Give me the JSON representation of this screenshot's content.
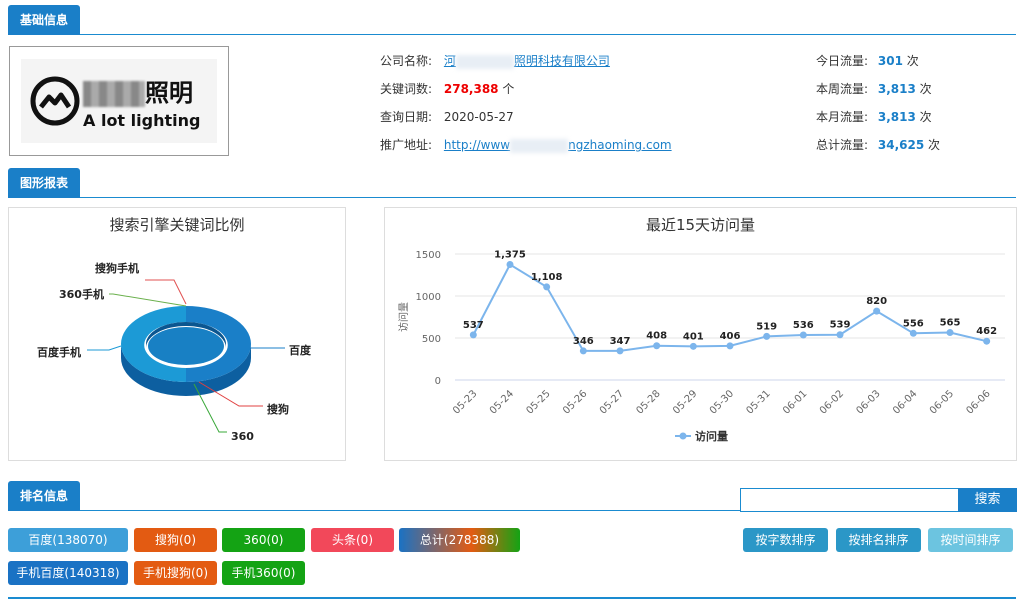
{
  "sections": {
    "basic": "基础信息",
    "chart": "图形报表",
    "ranking": "排名信息"
  },
  "logo": {
    "brand_cn": "照明",
    "brand_en": "A lot lighting"
  },
  "info": {
    "company_label": "公司名称:",
    "company_prefix": "河",
    "company_value": "照明科技有限公司",
    "keywords_label": "关键词数:",
    "keywords_value": "278,388",
    "keywords_unit": "个",
    "date_label": "查询日期:",
    "date_value": "2020-05-27",
    "url_label": "推广地址:",
    "url_prefix": "http://www",
    "url_suffix": "ngzhaoming.com",
    "today_label": "今日流量:",
    "today_value": "301",
    "week_label": "本周流量:",
    "week_value": "3,813",
    "month_label": "本月流量:",
    "month_value": "3,813",
    "total_label": "总计流量:",
    "total_value": "34,625",
    "unit": "次"
  },
  "chart_data": [
    {
      "type": "pie",
      "title": "搜索引擎关键词比例",
      "categories": [
        "百度",
        "搜狗",
        "360",
        "百度手机",
        "360手机",
        "搜狗手机"
      ],
      "values": [
        138070,
        0,
        0,
        140318,
        0,
        0
      ],
      "colors": [
        "#1a7fc8",
        "#e04040",
        "#3aa83a",
        "#1c9ad6",
        "#6ab04c",
        "#e05050"
      ]
    },
    {
      "type": "line",
      "title": "最近15天访问量",
      "ylabel": "访问量",
      "ylim": [
        0,
        1500
      ],
      "yticks": [
        0,
        500,
        1000,
        1500
      ],
      "categories": [
        "05-23",
        "05-24",
        "05-25",
        "05-26",
        "05-27",
        "05-28",
        "05-29",
        "05-30",
        "05-31",
        "06-01",
        "06-02",
        "06-03",
        "06-04",
        "06-05",
        "06-06"
      ],
      "series": [
        {
          "name": "访问量",
          "values": [
            537,
            1375,
            1108,
            346,
            347,
            408,
            401,
            406,
            519,
            536,
            539,
            820,
            556,
            565,
            462
          ]
        }
      ],
      "data_labels": [
        "537",
        "1,375",
        "1,108",
        "346",
        "347",
        "408",
        "401",
        "406",
        "519",
        "536",
        "539",
        "820",
        "556",
        "565",
        "462"
      ],
      "legend_position": "bottom",
      "color": "#7cb5ec"
    }
  ],
  "search": {
    "placeholder": "",
    "button": "搜索"
  },
  "filters": [
    {
      "label": "百度(138070)",
      "color": "#3d9fd9"
    },
    {
      "label": "搜狗(0)",
      "color": "#e35b12"
    },
    {
      "label": "360(0)",
      "color": "#14a314"
    },
    {
      "label": "头条(0)",
      "color": "#f2485a"
    },
    {
      "label": "总计(278388)",
      "color": "gradient"
    },
    {
      "label": "手机百度(140318)",
      "color": "#1a72c4"
    },
    {
      "label": "手机搜狗(0)",
      "color": "#e35b12"
    },
    {
      "label": "手机360(0)",
      "color": "#14a314"
    }
  ],
  "sort_buttons": [
    {
      "label": "按字数排序",
      "color": "#2b97c7"
    },
    {
      "label": "按排名排序",
      "color": "#2b97c7"
    },
    {
      "label": "按时间排序",
      "color": "#6cc4e0"
    }
  ]
}
